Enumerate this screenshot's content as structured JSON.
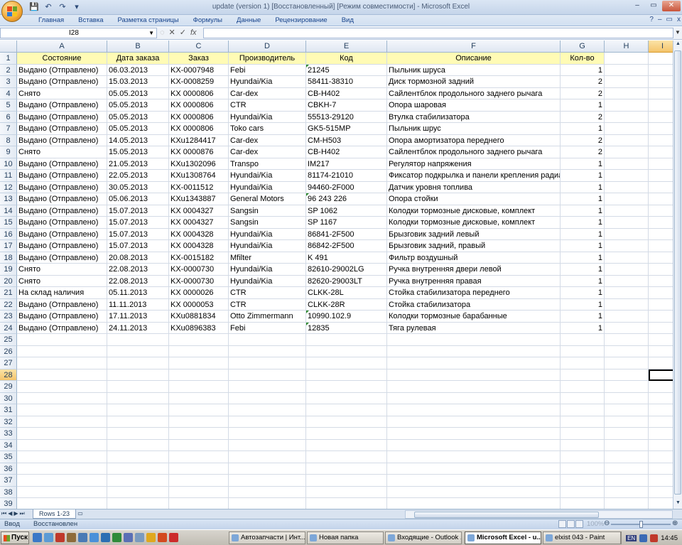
{
  "window": {
    "title": "update (version 1) [Восстановленный]  [Режим совместимости] - Microsoft Excel",
    "minimize": "–",
    "maximize": "▭",
    "close": "✕"
  },
  "qat": {
    "save": "💾",
    "undo": "↶",
    "redo": "↷",
    "menu": "▾"
  },
  "ribbon": {
    "tabs": [
      "Главная",
      "Вставка",
      "Разметка страницы",
      "Формулы",
      "Данные",
      "Рецензирование",
      "Вид"
    ],
    "help": "?",
    "mdi_min": "–",
    "mdi_restore": "▭",
    "mdi_close": "x"
  },
  "formula_bar": {
    "name_box": "I28",
    "fx_label": "fx",
    "value": ""
  },
  "columns": [
    {
      "letter": "A"
    },
    {
      "letter": "B"
    },
    {
      "letter": "C"
    },
    {
      "letter": "D"
    },
    {
      "letter": "E"
    },
    {
      "letter": "F"
    },
    {
      "letter": "G"
    },
    {
      "letter": "H"
    },
    {
      "letter": "I"
    }
  ],
  "table": {
    "headers": [
      "Состояние",
      "Дата заказа",
      "Заказ",
      "Производитель",
      "Код",
      "Описание",
      "Кол-во"
    ],
    "rows": [
      [
        "Выдано (Отправлено)",
        "06.03.2013",
        "KX-0007948",
        "Febi",
        "21245",
        "Пыльник шруса",
        "1"
      ],
      [
        "Выдано (Отправлено)",
        "15.03.2013",
        "KX-0008259",
        "Hyundai/Kia",
        "58411-38310",
        "Диск тормозной задний",
        "2"
      ],
      [
        "Снято",
        "05.05.2013",
        "KX 0000806",
        "Car-dex",
        "CB-H402",
        "Сайлентблок продольного заднего рычага",
        "2"
      ],
      [
        "Выдано (Отправлено)",
        "05.05.2013",
        "KX 0000806",
        "CTR",
        "CBKH-7",
        "Опора шаровая",
        "1"
      ],
      [
        "Выдано (Отправлено)",
        "05.05.2013",
        "KX 0000806",
        "Hyundai/Kia",
        "55513-29120",
        "Втулка стабилизатора",
        "2"
      ],
      [
        "Выдано (Отправлено)",
        "05.05.2013",
        "KX 0000806",
        "Toko cars",
        "GK5-515MP",
        "Пыльник шрус",
        "1"
      ],
      [
        "Выдано (Отправлено)",
        "14.05.2013",
        "KXu1284417",
        "Car-dex",
        "CM-H503",
        "Опора амортизатора переднего",
        "2"
      ],
      [
        "Снято",
        "15.05.2013",
        "KX 0000876",
        "Car-dex",
        "CB-H402",
        "Сайлентблок продольного заднего рычага",
        "2"
      ],
      [
        "Выдано (Отправлено)",
        "21.05.2013",
        "KXu1302096",
        "Transpo",
        "IM217",
        "Регулятор напряжения",
        "1"
      ],
      [
        "Выдано (Отправлено)",
        "22.05.2013",
        "KXu1308764",
        "Hyundai/Kia",
        "81174-21010",
        "Фиксатор подкрылка и панели крепления радиат",
        "1"
      ],
      [
        "Выдано (Отправлено)",
        "30.05.2013",
        "KX-0011512",
        "Hyundai/Kia",
        "94460-2F000",
        "Датчик уровня топлива",
        "1"
      ],
      [
        "Выдано (Отправлено)",
        "05.06.2013",
        "KXu1343887",
        "General Motors",
        "96 243 226",
        "Опора стойки",
        "1"
      ],
      [
        "Выдано (Отправлено)",
        "15.07.2013",
        "KX 0004327",
        "Sangsin",
        "SP 1062",
        "Колодки тормозные дисковые, комплект",
        "1"
      ],
      [
        "Выдано (Отправлено)",
        "15.07.2013",
        "KX 0004327",
        "Sangsin",
        "SP 1167",
        "Колодки тормозные дисковые, комплект",
        "1"
      ],
      [
        "Выдано (Отправлено)",
        "15.07.2013",
        "KX 0004328",
        "Hyundai/Kia",
        "86841-2F500",
        "Брызговик задний левый",
        "1"
      ],
      [
        "Выдано (Отправлено)",
        "15.07.2013",
        "KX 0004328",
        "Hyundai/Kia",
        "86842-2F500",
        "Брызговик задний, правый",
        "1"
      ],
      [
        "Выдано (Отправлено)",
        "20.08.2013",
        "KX-0015182",
        "Mfilter",
        "K 491",
        "Фильтр воздушный",
        "1"
      ],
      [
        "Снято",
        "22.08.2013",
        "KX-0000730",
        "Hyundai/Kia",
        "82610-29002LG",
        "Ручка внутренняя двери левой",
        "1"
      ],
      [
        "Снято",
        "22.08.2013",
        "KX-0000730",
        "Hyundai/Kia",
        "82620-29003LT",
        "Ручка внутренняя правая",
        "1"
      ],
      [
        "На склад наличия",
        "05.11.2013",
        "KX 0000026",
        "CTR",
        "CLKK-28L",
        "Стойка стабилизатора переднего",
        "1"
      ],
      [
        "Выдано (Отправлено)",
        "11.11.2013",
        "KX 0000053",
        "CTR",
        "CLKK-28R",
        "Стойка стабилизатора",
        "1"
      ],
      [
        "Выдано (Отправлено)",
        "17.11.2013",
        "KXu0881834",
        "Otto Zimmermann",
        "10990.102.9",
        "Колодки тормозные барабанные",
        "1"
      ],
      [
        "Выдано (Отправлено)",
        "24.11.2013",
        "KXu0896383",
        "Febi",
        "12835",
        "Тяга рулевая",
        "1"
      ]
    ],
    "row_numbers": [
      "1",
      "2",
      "3",
      "4",
      "5",
      "6",
      "7",
      "8",
      "9",
      "10",
      "11",
      "12",
      "13",
      "14",
      "15",
      "16",
      "17",
      "18",
      "19",
      "20",
      "21",
      "22",
      "23",
      "24",
      "25",
      "26",
      "27",
      "28",
      "29",
      "30",
      "31",
      "32",
      "33",
      "34",
      "35",
      "36",
      "37",
      "38",
      "39"
    ],
    "active_cell": "I28"
  },
  "sheets": {
    "nav": [
      "⏮",
      "◀",
      "▶",
      "⏭"
    ],
    "active": "Rows 1-23"
  },
  "status": {
    "mode": "Ввод",
    "recovered": "Восстановлен",
    "zoom": "100%"
  },
  "taskbar": {
    "start": "Пуск",
    "buttons": [
      {
        "label": "Автозапчасти | Инт..."
      },
      {
        "label": "Новая папка"
      },
      {
        "label": "Входящие - Outlook ..."
      },
      {
        "label": "Microsoft Excel - u...",
        "active": true
      },
      {
        "label": "elxist 043 - Paint"
      }
    ],
    "lang": "EN",
    "time": "14:45"
  }
}
